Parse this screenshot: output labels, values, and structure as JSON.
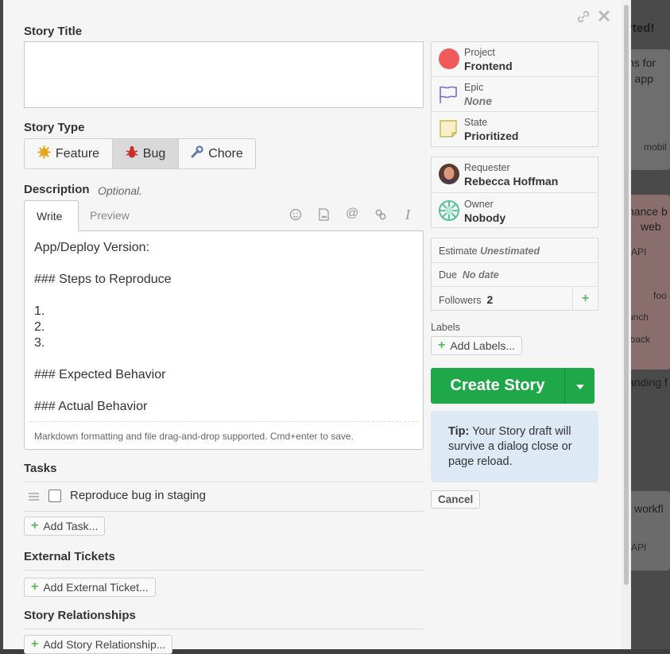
{
  "background": {
    "texts": [
      "rted!",
      "ns for",
      "r app",
      "mobil",
      "hance b",
      "web",
      "API",
      "foo",
      "unch",
      "lback",
      "anding f",
      "workfl",
      "API"
    ]
  },
  "dialog": {
    "story_title": {
      "label": "Story Title",
      "value": ""
    },
    "story_type": {
      "label": "Story Type",
      "options": [
        "Feature",
        "Bug",
        "Chore"
      ],
      "selected": "Bug"
    },
    "description": {
      "label": "Description",
      "optional": "Optional.",
      "tabs": [
        "Write",
        "Preview"
      ],
      "active_tab": "Write",
      "lines": [
        "App/Deploy Version:",
        "",
        "### Steps to Reproduce",
        "",
        "1.",
        "2.",
        "3.",
        "",
        "### Expected Behavior",
        "",
        "### Actual Behavior"
      ],
      "footer": "Markdown formatting and file drag-and-drop supported. Cmd+enter to save."
    },
    "tasks": {
      "label": "Tasks",
      "items": [
        {
          "text": "Reproduce bug in staging",
          "checked": false
        }
      ],
      "add_label": "Add Task..."
    },
    "external_tickets": {
      "label": "External Tickets",
      "add_label": "Add External Ticket..."
    },
    "relationships": {
      "label": "Story Relationships",
      "add_label": "Add Story Relationship..."
    },
    "sidebar": {
      "project": {
        "label": "Project",
        "value": "Frontend"
      },
      "epic": {
        "label": "Epic",
        "value": "None"
      },
      "state": {
        "label": "State",
        "value": "Prioritized"
      },
      "requester": {
        "label": "Requester",
        "value": "Rebecca Hoffman"
      },
      "owner": {
        "label": "Owner",
        "value": "Nobody"
      },
      "estimate": {
        "label": "Estimate",
        "value": "Unestimated"
      },
      "due": {
        "label": "Due",
        "value": "No date"
      },
      "followers": {
        "label": "Followers",
        "value": "2"
      },
      "labels": {
        "label": "Labels",
        "add_label": "Add Labels..."
      }
    },
    "create_button": "Create Story",
    "tip": {
      "bold": "Tip:",
      "text": " Your Story draft will survive a dialog close or page reload."
    },
    "cancel": "Cancel"
  },
  "colors": {
    "create": "#1fa84a",
    "project_dot": "#f05a5a",
    "tip_bg": "#dde9f4"
  }
}
